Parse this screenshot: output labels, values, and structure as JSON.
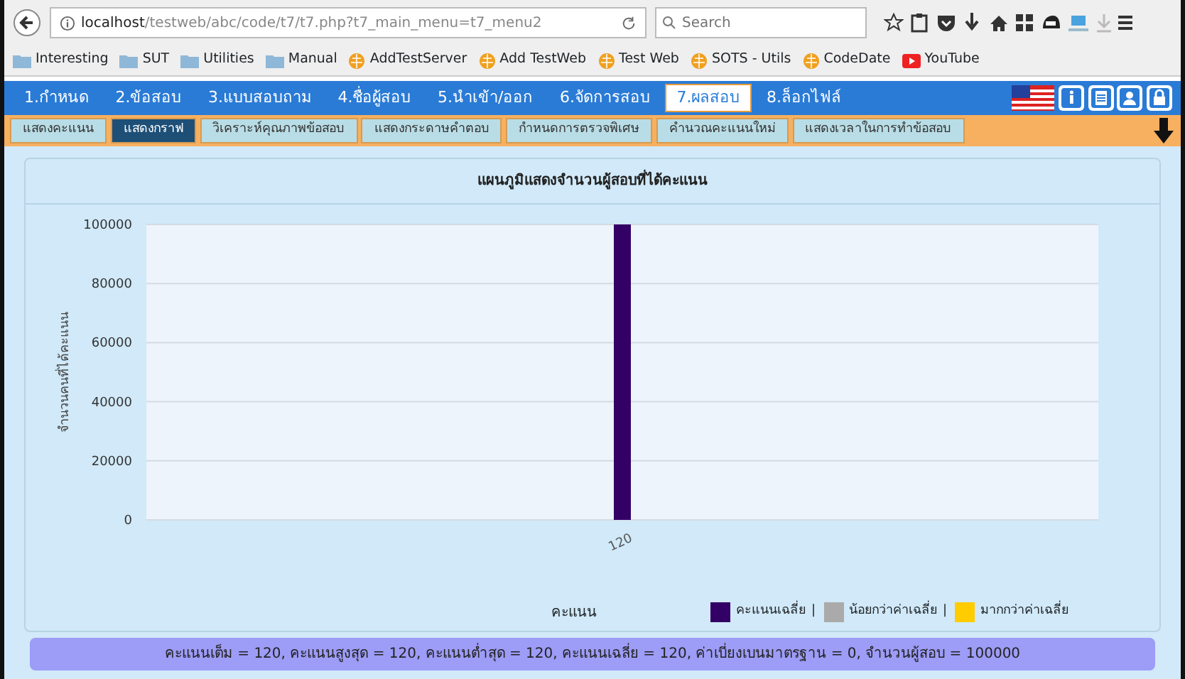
{
  "browser": {
    "url_host": "localhost",
    "url_path": "/testweb/abc/code/t7/t7.php?t7_main_menu=t7_menu2",
    "search": {
      "placeholder": "Search"
    }
  },
  "bookmarks": [
    {
      "kind": "folder",
      "label": "Interesting"
    },
    {
      "kind": "folder",
      "label": "SUT"
    },
    {
      "kind": "folder",
      "label": "Utilities"
    },
    {
      "kind": "folder",
      "label": "Manual"
    },
    {
      "kind": "site",
      "label": "AddTestServer"
    },
    {
      "kind": "site",
      "label": "Add TestWeb"
    },
    {
      "kind": "site",
      "label": "Test Web"
    },
    {
      "kind": "site",
      "label": "SOTS - Utils"
    },
    {
      "kind": "site",
      "label": "CodeDate"
    },
    {
      "kind": "video",
      "label": "YouTube"
    }
  ],
  "main_menu": [
    {
      "label": "1.กำหนด",
      "selected": false
    },
    {
      "label": "2.ข้อสอบ",
      "selected": false
    },
    {
      "label": "3.แบบสอบถาม",
      "selected": false
    },
    {
      "label": "4.ชื่อผู้สอบ",
      "selected": false
    },
    {
      "label": "5.นำเข้า/ออก",
      "selected": false
    },
    {
      "label": "6.จัดการสอบ",
      "selected": false
    },
    {
      "label": "7.ผลสอบ",
      "selected": true
    },
    {
      "label": "8.ล็อกไฟล์",
      "selected": false
    }
  ],
  "sub_menu": [
    {
      "label": "แสดงคะแนน",
      "selected": false
    },
    {
      "label": "แสดงกราฟ",
      "selected": true
    },
    {
      "label": "วิเคราะห์คุณภาพข้อสอบ",
      "selected": false
    },
    {
      "label": "แสดงกระดาษคำตอบ",
      "selected": false
    },
    {
      "label": "กำหนดการตรวจพิเศษ",
      "selected": false
    },
    {
      "label": "คำนวณคะแนนใหม่",
      "selected": false
    },
    {
      "label": "แสดงเวลาในการทำข้อสอบ",
      "selected": false
    }
  ],
  "graph": {
    "legend_separator": "|",
    "chart_data": {
      "type": "bar",
      "title": "แผนภูมิแสดงจำนวนผู้สอบที่ได้คะแนน",
      "xlabel": "คะแนน",
      "ylabel": "จำนวนคนที่ได้คะแนน",
      "categories": [
        "120"
      ],
      "series": [
        {
          "name": "คะแนนเฉลี่ย",
          "color": "#330066",
          "values": [
            100000
          ]
        },
        {
          "name": "น้อยกว่าค่าเฉลี่ย",
          "color": "#aaaaaa",
          "values": [
            null
          ]
        },
        {
          "name": "มากกว่าค่าเฉลี่ย",
          "color": "#ffcc00",
          "values": [
            null
          ]
        }
      ],
      "grid": true,
      "ylim": [
        0,
        100000
      ],
      "yticks": [
        0,
        20000,
        40000,
        60000,
        80000,
        100000
      ]
    },
    "summary": "คะแนนเต็ม = 120, คะแนนสูงสุด = 120, คะแนนต่ำสุด = 120, คะแนนเฉลี่ย = 120, ค่าเบี่ยงเบนมาตรฐาน = 0, จำนวนผู้สอบ = 100000"
  }
}
